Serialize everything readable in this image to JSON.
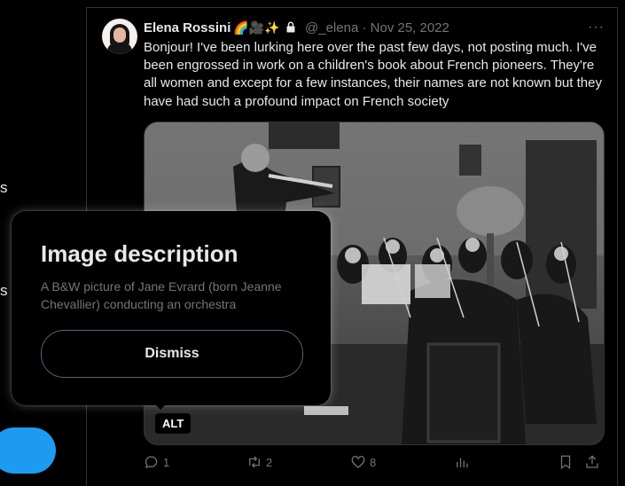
{
  "sidebar": {
    "fragments": [
      "s",
      "s"
    ]
  },
  "tweet": {
    "author_name": "Elena Rossini",
    "author_emojis": "🌈🎥✨",
    "handle": "@_elena",
    "separator": "·",
    "date": "Nov 25, 2022",
    "more_label": "···",
    "text": "Bonjour! I've been lurking here over the past few days, not posting much. I've been engrossed in work on a children's book about French pioneers. They're all women and except for a few instances, their names are not known but they have had such a profound impact on French society",
    "alt_badge": "ALT",
    "counts": {
      "replies": "1",
      "reposts": "2",
      "likes": "8"
    }
  },
  "image_description": {
    "title": "Image description",
    "body": "A B&W picture of Jane Evrard (born Jeanne Chevallier) conducting an orchestra",
    "dismiss_label": "Dismiss"
  },
  "colors": {
    "background": "#000000",
    "text_primary": "#e7e9ea",
    "text_secondary": "#71767b",
    "accent": "#1d9bf0",
    "border": "#2f3336"
  },
  "icons": [
    "reply-icon",
    "repost-icon",
    "like-icon",
    "views-icon",
    "bookmark-icon",
    "share-icon",
    "lock-icon",
    "more-icon"
  ]
}
